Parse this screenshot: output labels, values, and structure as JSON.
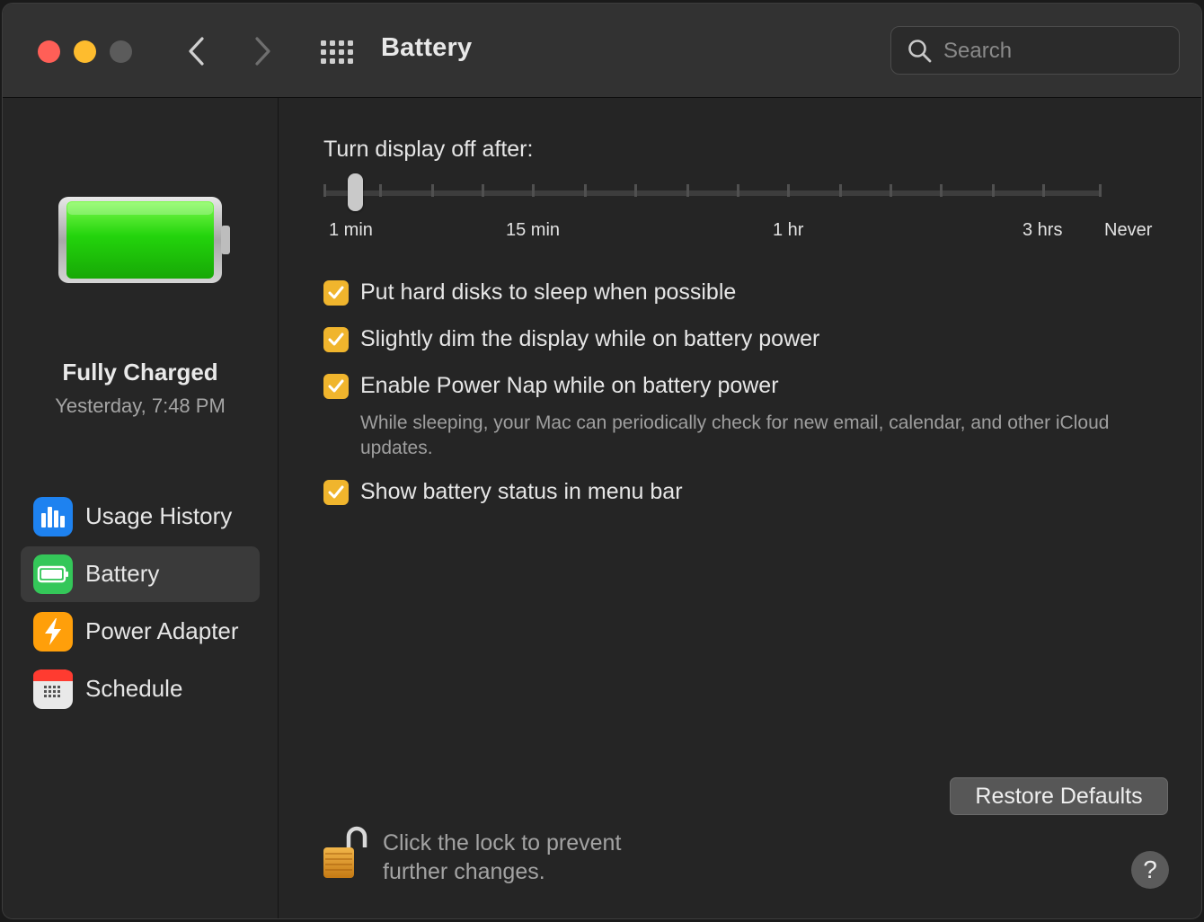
{
  "window": {
    "title": "Battery",
    "search_placeholder": "Search"
  },
  "sidebar": {
    "status_title": "Fully Charged",
    "status_time": "Yesterday, 7:48 PM",
    "items": [
      {
        "label": "Usage History",
        "icon": "usage-history-icon",
        "selected": false
      },
      {
        "label": "Battery",
        "icon": "battery-icon",
        "selected": true
      },
      {
        "label": "Power Adapter",
        "icon": "power-adapter-icon",
        "selected": false
      },
      {
        "label": "Schedule",
        "icon": "schedule-icon",
        "selected": false
      }
    ]
  },
  "main": {
    "slider_title": "Turn display off after:",
    "slider_value": "1 min",
    "slider_labels": [
      "1 min",
      "15 min",
      "1 hr",
      "3 hrs",
      "Never"
    ],
    "checkboxes": [
      {
        "label": "Put hard disks to sleep when possible",
        "checked": true
      },
      {
        "label": "Slightly dim the display while on battery power",
        "checked": true
      },
      {
        "label": "Enable Power Nap while on battery power",
        "checked": true
      },
      {
        "label": "Show battery status in menu bar",
        "checked": true
      }
    ],
    "power_nap_description": "While sleeping, your Mac can periodically check for new email, calendar, and other iCloud updates.",
    "restore_label": "Restore Defaults",
    "lock_text": "Click the lock to prevent further changes.",
    "help_label": "?"
  },
  "colors": {
    "accent_checkbox": "#f0b52d",
    "battery_green": "#2bd40f",
    "close": "#ff5f57",
    "minimize": "#febc2e"
  }
}
